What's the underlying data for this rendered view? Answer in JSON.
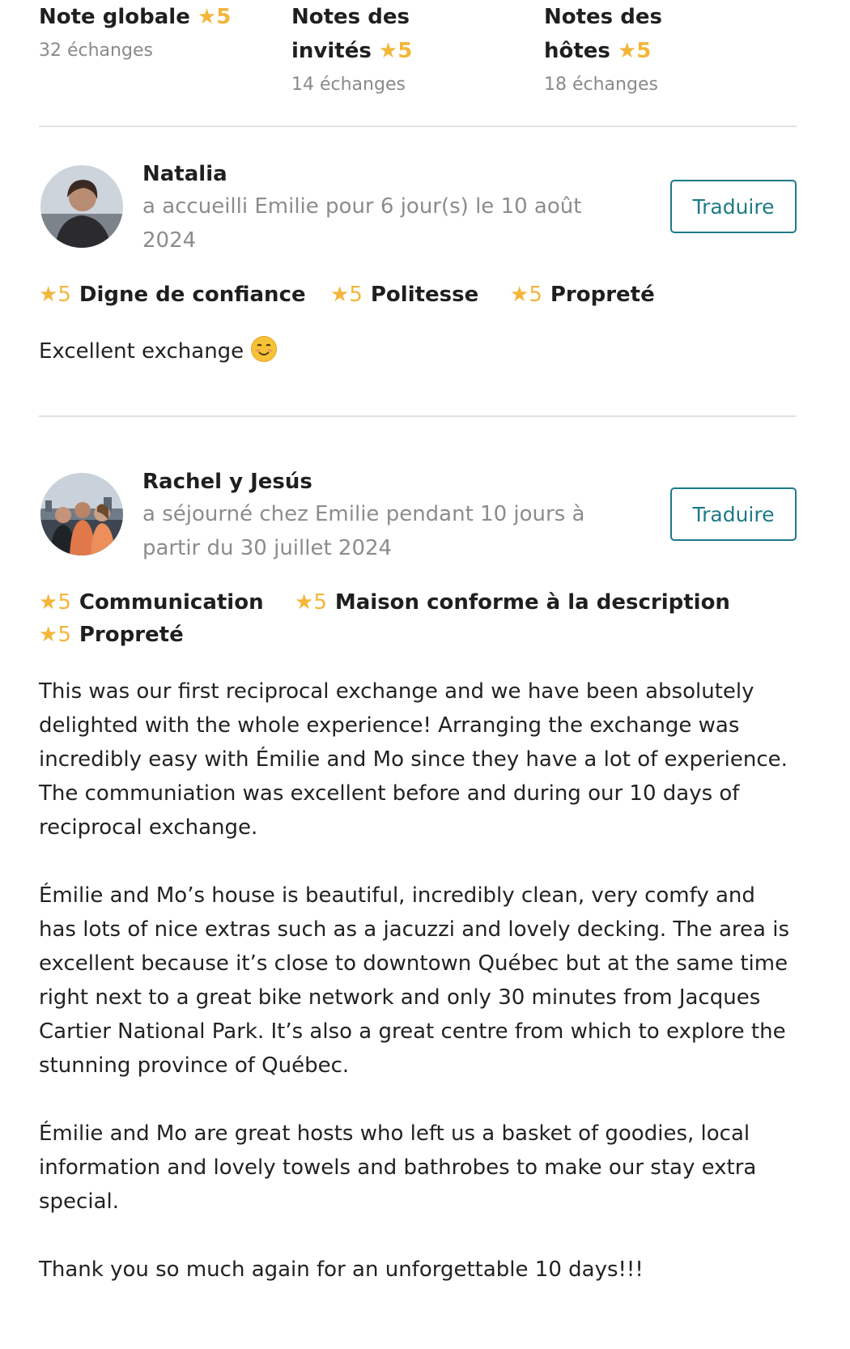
{
  "summary": {
    "overall": {
      "title": "Note globale",
      "score": "5",
      "count": "32 échanges"
    },
    "guests": {
      "title_line1": "Notes des",
      "title_line2": "invités",
      "score": "5",
      "count": "14 échanges"
    },
    "hosts": {
      "title_line1": "Notes des",
      "title_line2": "hôtes",
      "score": "5",
      "count": "18 échanges"
    }
  },
  "star_glyph": "★",
  "colors": {
    "star": "#f3b63a",
    "accent": "#1e7a86",
    "muted": "#8c8c8c"
  },
  "reviews": [
    {
      "name": "Natalia",
      "meta": "a accueilli Emilie pour 6 jour(s) le 10 août 2024",
      "translate_label": "Traduire",
      "ratings": [
        {
          "score": "5",
          "label": "Digne de confiance"
        },
        {
          "score": "5",
          "label": "Politesse"
        },
        {
          "score": "5",
          "label": "Propreté"
        }
      ],
      "text": "Excellent exchange",
      "emoji": "smiling-face-emoji"
    },
    {
      "name": "Rachel y Jesús",
      "meta": "a séjourné chez Emilie pendant 10 jours à partir du 30 juillet 2024",
      "translate_label": "Traduire",
      "ratings": [
        {
          "score": "5",
          "label": "Communication"
        },
        {
          "score": "5",
          "label": "Maison conforme à la description"
        },
        {
          "score": "5",
          "label": "Propreté"
        }
      ],
      "paragraphs": [
        "This was our first reciprocal exchange and we have been absolutely delighted with the whole experience! Arranging the exchange was incredibly easy with Émilie and Mo since they have a lot of experience. The communiation was excellent before and during our 10 days of reciprocal exchange.",
        "Émilie and Mo’s house is beautiful, incredibly clean, very comfy and has lots of nice extras such as a jacuzzi and lovely decking. The area is excellent because it’s close to downtown Québec but at the same time right next to a great bike network and only 30 minutes from Jacques Cartier National Park. It’s also a great centre from which to explore the stunning province of Québec.",
        "Émilie and Mo are great hosts who left us a basket of goodies, local information and lovely towels and bathrobes to make our stay extra special.",
        "Thank you so much again for an unforgettable 10 days!!!"
      ]
    }
  ]
}
